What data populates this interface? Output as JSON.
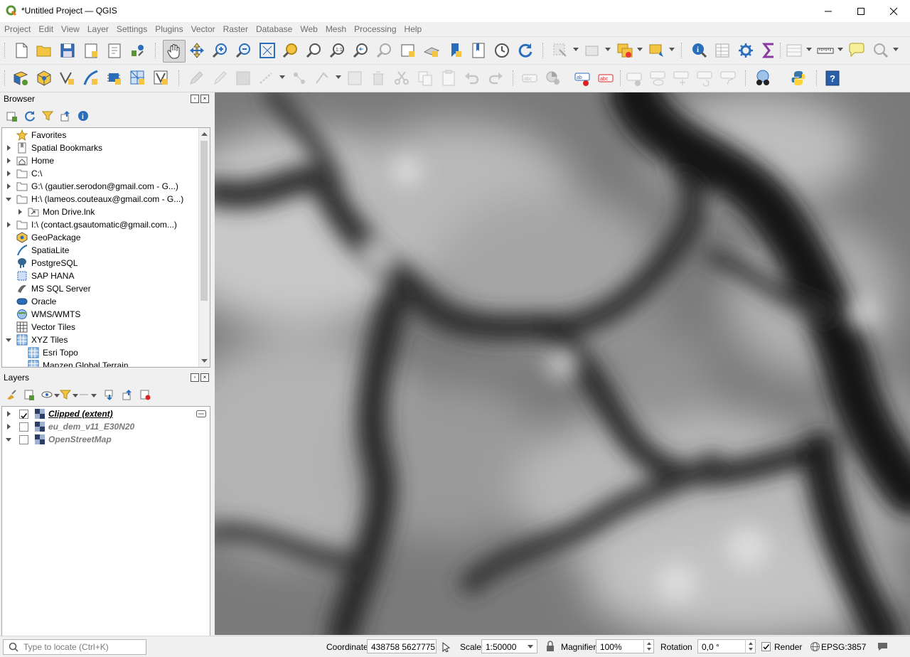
{
  "window": {
    "title": "*Untitled Project — QGIS"
  },
  "menu": {
    "items": [
      "Project",
      "Edit",
      "View",
      "Layer",
      "Settings",
      "Plugins",
      "Vector",
      "Raster",
      "Database",
      "Web",
      "Mesh",
      "Processing",
      "Help"
    ]
  },
  "browser": {
    "title": "Browser",
    "items": [
      {
        "label": "Favorites",
        "icon": "star-icon",
        "arrow": "none",
        "indent": 0
      },
      {
        "label": "Spatial Bookmarks",
        "icon": "bookmark-icon",
        "arrow": "right",
        "indent": 0
      },
      {
        "label": "Home",
        "icon": "home-folder-icon",
        "arrow": "right",
        "indent": 0
      },
      {
        "label": "C:\\",
        "icon": "folder-icon",
        "arrow": "right",
        "indent": 0
      },
      {
        "label": "G:\\ (gautier.serodon@gmail.com - G...)",
        "icon": "folder-icon",
        "arrow": "right",
        "indent": 0
      },
      {
        "label": "H:\\ (lameos.couteaux@gmail.com - G...)",
        "icon": "folder-icon",
        "arrow": "down",
        "indent": 0
      },
      {
        "label": "Mon Drive.lnk",
        "icon": "shortcut-icon",
        "arrow": "right",
        "indent": 1
      },
      {
        "label": "I:\\ (contact.gsautomatic@gmail.com...)",
        "icon": "folder-icon",
        "arrow": "right",
        "indent": 0
      },
      {
        "label": "GeoPackage",
        "icon": "geopackage-icon",
        "arrow": "none",
        "indent": 0
      },
      {
        "label": "SpatiaLite",
        "icon": "spatialite-icon",
        "arrow": "none",
        "indent": 0
      },
      {
        "label": "PostgreSQL",
        "icon": "postgresql-icon",
        "arrow": "none",
        "indent": 0
      },
      {
        "label": "SAP HANA",
        "icon": "sap-hana-icon",
        "arrow": "none",
        "indent": 0
      },
      {
        "label": "MS SQL Server",
        "icon": "mssql-icon",
        "arrow": "none",
        "indent": 0
      },
      {
        "label": "Oracle",
        "icon": "oracle-icon",
        "arrow": "none",
        "indent": 0
      },
      {
        "label": "WMS/WMTS",
        "icon": "wms-icon",
        "arrow": "none",
        "indent": 0
      },
      {
        "label": "Vector Tiles",
        "icon": "vector-tiles-icon",
        "arrow": "none",
        "indent": 0
      },
      {
        "label": "XYZ Tiles",
        "icon": "xyz-tiles-icon",
        "arrow": "down",
        "indent": 0
      },
      {
        "label": "Esri Topo",
        "icon": "xyz-tiles-icon",
        "arrow": "none",
        "indent": 1
      },
      {
        "label": "Mapzen Global Terrain",
        "icon": "xyz-tiles-icon",
        "arrow": "none",
        "indent": 1
      }
    ]
  },
  "layers": {
    "title": "Layers",
    "items": [
      {
        "label": "Clipped (extent)",
        "checked": true,
        "active": true
      },
      {
        "label": "eu_dem_v11_E30N20",
        "checked": false,
        "active": false
      },
      {
        "label": "OpenStreetMap",
        "checked": false,
        "active": false
      }
    ]
  },
  "status": {
    "locate_placeholder": "Type to locate (Ctrl+K)",
    "coordinate_label": "Coordinate",
    "coordinate_value": "438758  5627775",
    "scale_label": "Scale",
    "scale_value": "1:50000",
    "magnifier_label": "Magnifier",
    "magnifier_value": "100%",
    "rotation_label": "Rotation",
    "rotation_value": "0,0 °",
    "render_label": "Render",
    "render_checked": true,
    "crs_label": "EPSG:3857"
  },
  "colors": {
    "qgis_green": "#589632",
    "accent_blue": "#2a6ebb",
    "selection": "#cce8ff"
  }
}
